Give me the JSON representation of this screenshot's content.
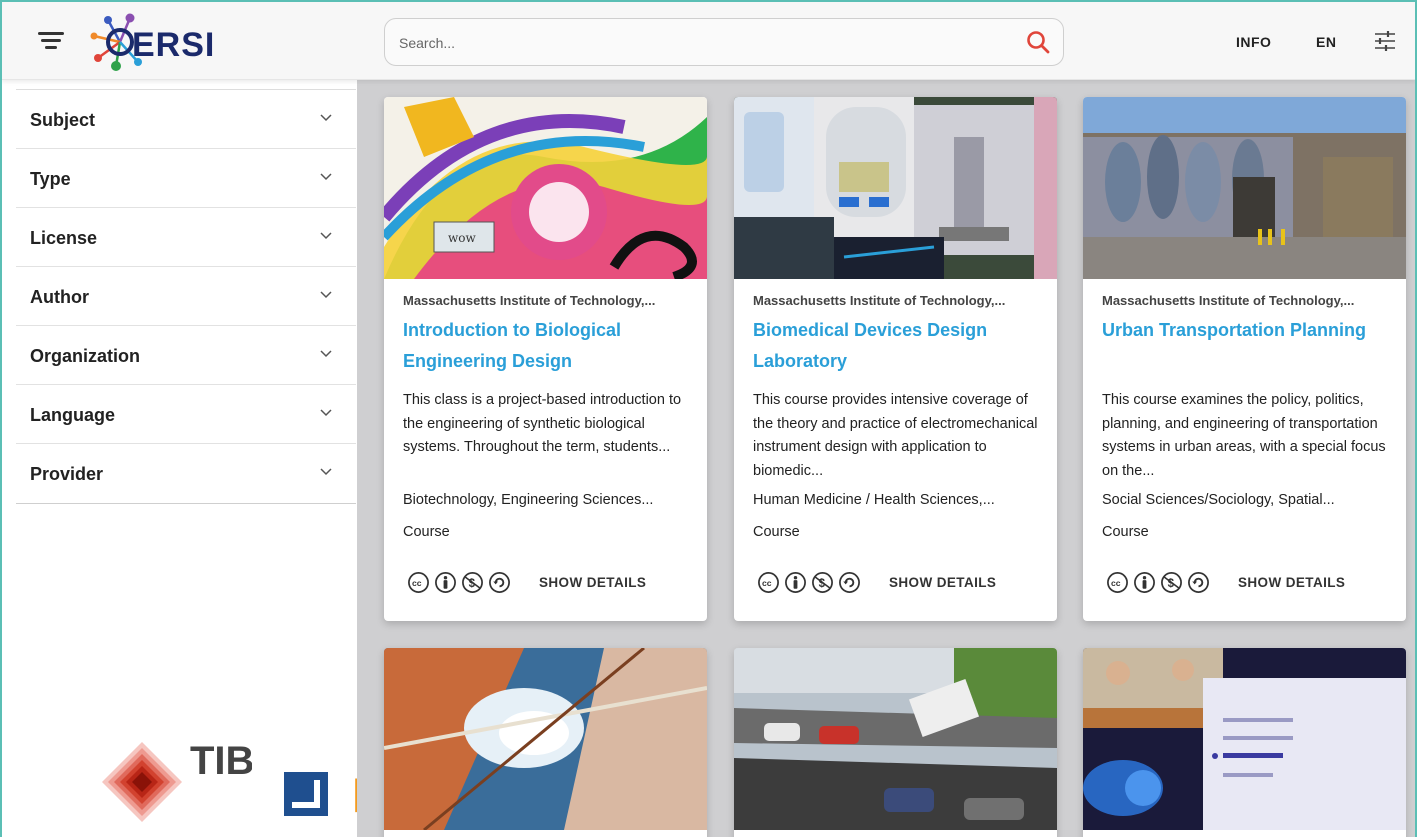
{
  "header": {
    "logo_text": "ERSI",
    "search": {
      "placeholder": "Search..."
    },
    "info_label": "INFO",
    "language_label": "EN"
  },
  "sidebar": {
    "facets": [
      {
        "label": "Subject"
      },
      {
        "label": "Type"
      },
      {
        "label": "License"
      },
      {
        "label": "Author"
      },
      {
        "label": "Organization"
      },
      {
        "label": "Language"
      },
      {
        "label": "Provider"
      }
    ],
    "logos": {
      "tib": "TIB",
      "hbz": "hbz"
    }
  },
  "results": [
    {
      "organization": "Massachusetts Institute of Technology,...",
      "title": "Introduction to Biological Engineering Design",
      "description": "This class is a project-based introduction to the engineering of synthetic biological systems. Throughout the term, students...",
      "subjects": "Biotechnology, Engineering Sciences...",
      "type": "Course",
      "license_icons": [
        "cc-icon",
        "attribution-icon",
        "noncommercial-icon",
        "sharealike-icon"
      ],
      "action_label": "SHOW DETAILS"
    },
    {
      "organization": "Massachusetts Institute of Technology,...",
      "title": "Biomedical Devices Design Laboratory",
      "description": "This course provides intensive coverage of the theory and practice of electromechanical instrument design with application to biomedic...",
      "subjects": "Human Medicine / Health Sciences,...",
      "type": "Course",
      "license_icons": [
        "cc-icon",
        "attribution-icon",
        "noncommercial-icon",
        "sharealike-icon"
      ],
      "action_label": "SHOW DETAILS"
    },
    {
      "organization": "Massachusetts Institute of Technology,...",
      "title": "Urban Transportation Planning",
      "description": "This course examines the policy, politics, planning, and engineering of transportation systems in urban areas, with a special focus on the...",
      "subjects": "Social Sciences/Sociology, Spatial...",
      "type": "Course",
      "license_icons": [
        "cc-icon",
        "attribution-icon",
        "noncommercial-icon",
        "sharealike-icon"
      ],
      "action_label": "SHOW DETAILS"
    },
    {
      "image": "aerial-satellite-photo"
    },
    {
      "image": "collapsed-highway-photo"
    },
    {
      "image": "defcon-conference-photo"
    }
  ],
  "colors": {
    "accent": "#2a9fd8",
    "frame": "#5bbfb5",
    "search_icon": "#e0453a",
    "main_bg": "#cfcfd1"
  }
}
